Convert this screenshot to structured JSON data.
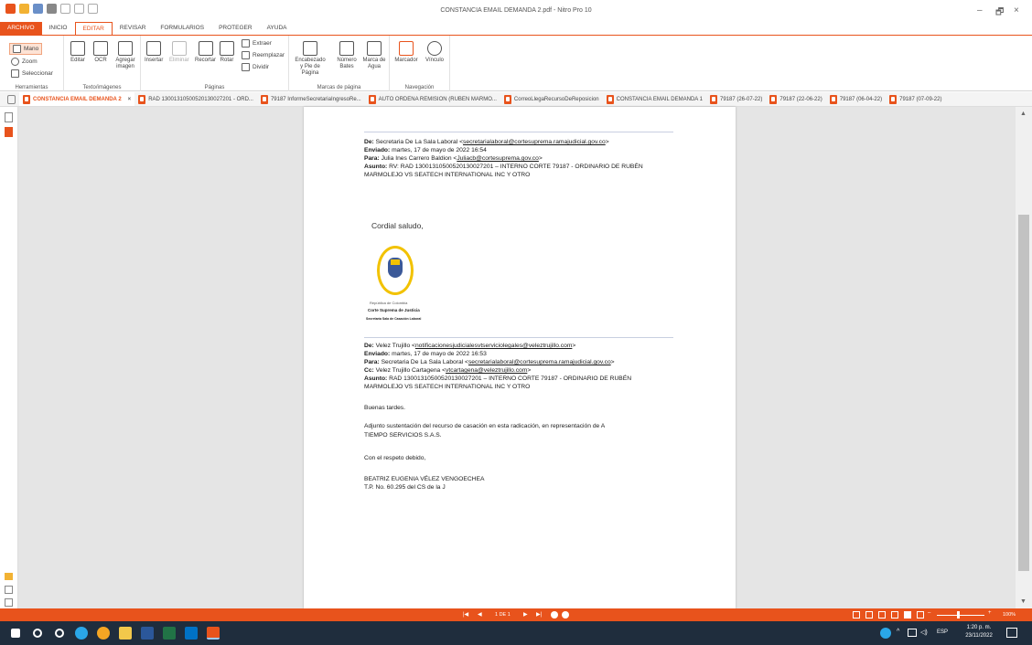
{
  "app": {
    "title": "CONSTANCIA EMAIL DEMANDA 2.pdf - Nitro Pro 10"
  },
  "window_controls": {
    "minimize": "–",
    "restore": "🗗",
    "close": "×"
  },
  "menu": [
    "ARCHIVO",
    "INICIO",
    "EDITAR",
    "REVISAR",
    "FORMULARIOS",
    "PROTEGER",
    "AYUDA"
  ],
  "ribbon": {
    "herramientas": {
      "label": "Herramientas",
      "mano": "Mano",
      "zoom": "Zoom",
      "seleccionar": "Seleccionar"
    },
    "texto": {
      "label": "Texto/imágenes",
      "editar": "Editar",
      "ocr": "OCR",
      "agregar": "Agregar imagen"
    },
    "paginas": {
      "label": "Páginas",
      "insertar": "Insertar",
      "eliminar": "Eliminar",
      "recortar": "Recortar",
      "rotar": "Rotar",
      "extraer": "Extraer",
      "reemplazar": "Reemplazar",
      "dividir": "Dividir"
    },
    "marcas": {
      "label": "Marcas de página",
      "encabezado": "Encabezado y Pie de Página",
      "numero": "Número Bates",
      "marca": "Marca de Agua"
    },
    "navegacion": {
      "label": "Navegación",
      "marcador": "Marcador",
      "vinculo": "Vínculo"
    }
  },
  "tabs": [
    "CONSTANCIA EMAIL DEMANDA 2",
    "RAD 13001310500520130027201 - ORD...",
    "79187 InformeSecretariaIngresoRe...",
    "AUTO ORDENA REMISION (RUBEN MARMO...",
    "CorreoLlegaRecursoDeReposicion",
    "CONSTANCIA EMAIL DEMANDA 1",
    "79187 (26-07-22)",
    "79187 (22-06-22)",
    "79187 (06-04-22)",
    "79187 (07-09-22)"
  ],
  "tab_close": "×",
  "doc": {
    "e1": {
      "de_l": "De:",
      "de_v": "Secretaria De La Sala Laboral <",
      "de_link": "secretarialaboral@cortesuprema.ramajudicial.gov.co",
      "de_end": ">",
      "env_l": "Enviado:",
      "env_v": "martes, 17 de mayo de 2022 16:54",
      "para_l": "Para:",
      "para_v": "Julia Ines Carrero Baldion <",
      "para_link": "Juliacb@cortesuprema.gov.co",
      "para_end": ">",
      "asunto_l": "Asunto:",
      "asunto_v": "RV: RAD 13001310500520130027201 – INTERNO CORTE 79187 - ORDINARIO DE RUBÉN",
      "asunto_v2": "MARMOLEJO VS SEATECH INTERNATIONAL INC Y OTRO"
    },
    "saludo": "Cordial saludo,",
    "seal": {
      "l1": "República de Colombia",
      "l2": "Corte Suprema de Justicia",
      "l3": "Secretaría Sala de Casación Laboral"
    },
    "e2": {
      "de_l": "De:",
      "de_v": "Velez Trujillo <",
      "de_link": "notificacionesjudicialesvtserviciolegales@veleztrujillo.com",
      "de_end": ">",
      "env_l": "Enviado:",
      "env_v": "martes, 17 de mayo de 2022 16:53",
      "para_l": "Para:",
      "para_v": "Secretaria De La Sala Laboral <",
      "para_link": "secretarialaboral@cortesuprema.ramajudicial.gov.co",
      "para_end": ">",
      "cc_l": "Cc:",
      "cc_v": "Velez Trujillo Cartagena <",
      "cc_link": "vtcartagena@veleztrujillo.com",
      "cc_end": ">",
      "asunto_l": "Asunto:",
      "asunto_v": "RAD 13001310500520130027201 – INTERNO CORTE 79187 - ORDINARIO DE RUBÉN",
      "asunto_v2": "MARMOLEJO VS SEATECH INTERNATIONAL INC Y OTRO"
    },
    "buenas": "Buenas tardes.",
    "adjunto1": "Adjunto sustentación del recurso de casación en esta radicación, en representación de A",
    "adjunto2": "TIEMPO SERVICIOS S.A.S.",
    "respeto": "Con el respeto debido,",
    "firma1": "BEATRIZ EUGENIA VÉLEZ VENGOECHEA",
    "firma2": "T.P. No. 60.295 del CS de la J"
  },
  "status": {
    "page": "1 DE 1",
    "zoom": "100%"
  },
  "taskbar": {
    "lang": "ESP",
    "time": "1:20 p. m.",
    "date": "23/11/2022"
  }
}
